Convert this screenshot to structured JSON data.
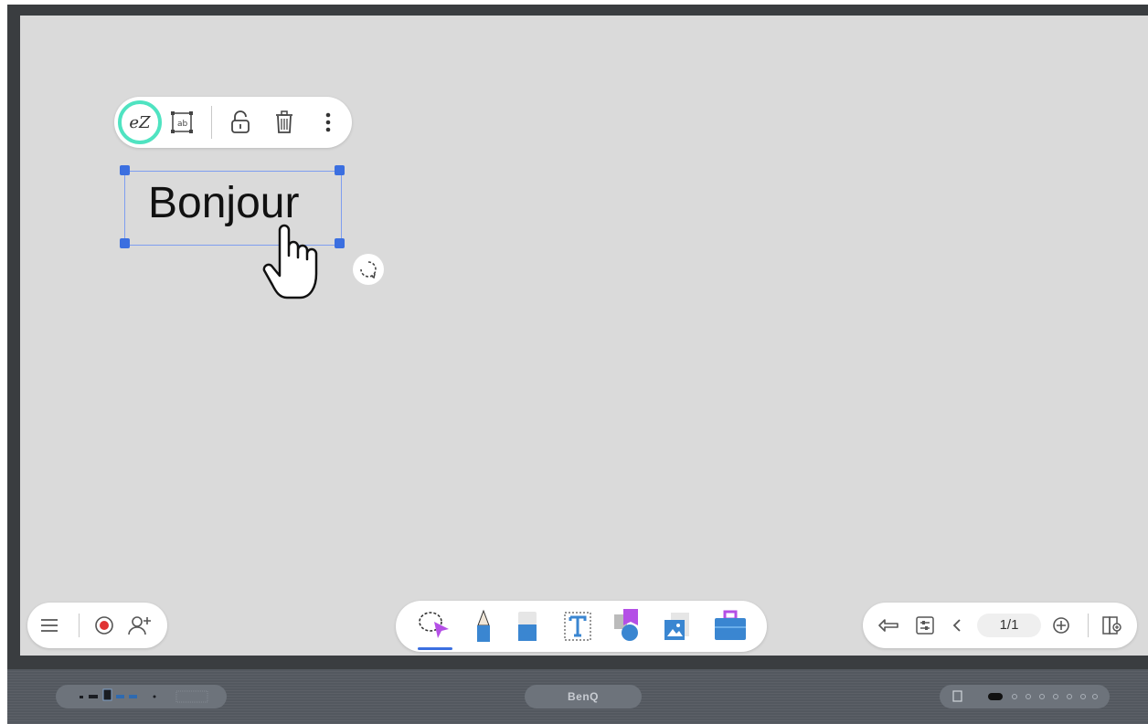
{
  "toolbar_top": {
    "ez_label": "eZ",
    "icons": [
      "ez-handwriting-convert-icon",
      "text-convert-icon",
      "unlock-icon",
      "trash-icon",
      "more-vertical-icon"
    ]
  },
  "canvas": {
    "text_object": "Bonjour"
  },
  "bottom_left": {
    "icons": [
      "menu-icon",
      "record-icon",
      "add-user-icon"
    ]
  },
  "bottom_center": {
    "tools": [
      "select-tool",
      "pen-tool",
      "eraser-tool",
      "text-tool",
      "shapes-tool",
      "image-tool",
      "toolbox-tool"
    ]
  },
  "bottom_right": {
    "page_indicator": "1/1",
    "icons": [
      "undo-icon",
      "settings-icon",
      "previous-page-icon",
      "add-page-icon",
      "page-overview-icon"
    ]
  },
  "hardware": {
    "brand": "BenQ"
  },
  "colors": {
    "canvas_bg": "#dadada",
    "selection_handle": "#3b6fe0",
    "ez_ring": "#4fe3c1",
    "accent_pen": "#3a86d1",
    "select_arrow": "#b44fe6"
  }
}
